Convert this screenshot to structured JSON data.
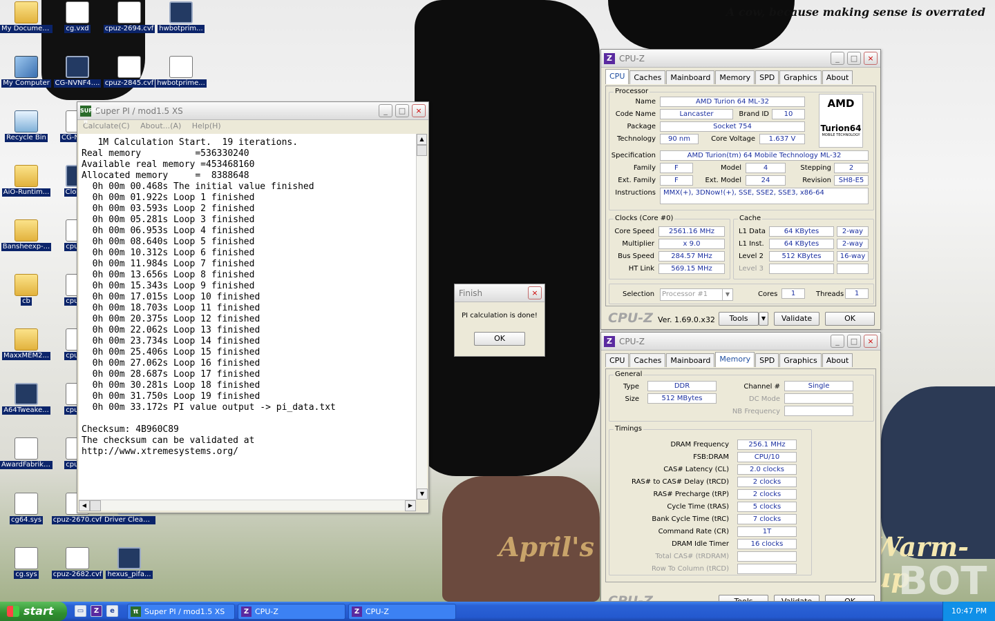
{
  "desktop": {
    "wallpaper_title": "A cow, because making sense is overrated",
    "wallpaper_text_1": "April's",
    "wallpaper_text_2": "Warm-up",
    "wallpaper_text_3": "BOT",
    "icons": [
      {
        "label": "My Documents",
        "type": "folder"
      },
      {
        "label": "cg.vxd",
        "type": "doc"
      },
      {
        "label": "cpuz-2694.cvf",
        "type": "doc"
      },
      {
        "label": "hwbotprim...",
        "type": "app"
      },
      {
        "label": "My Computer",
        "type": "pc"
      },
      {
        "label": "CG-NVNF4....",
        "type": "app"
      },
      {
        "label": "cpuz-2845.cvf",
        "type": "doc"
      },
      {
        "label": "hwbotprime...",
        "type": "doc"
      },
      {
        "label": "Recycle Bin",
        "type": "bin"
      },
      {
        "label": "CG-NVNF",
        "type": "doc"
      },
      {
        "label": "AiO-Runtim...",
        "type": "folder"
      },
      {
        "label": "ClockG",
        "type": "app"
      },
      {
        "label": "Bansheexp-...",
        "type": "folder"
      },
      {
        "label": "cpuz-2",
        "type": "doc"
      },
      {
        "label": "cb",
        "type": "folder"
      },
      {
        "label": "cpuz-2",
        "type": "doc"
      },
      {
        "label": "MaxxMEM2...",
        "type": "folder"
      },
      {
        "label": "cpuz-2",
        "type": "doc"
      },
      {
        "label": "A64Tweake...",
        "type": "app"
      },
      {
        "label": "cpuz-2",
        "type": "doc"
      },
      {
        "label": "AwardFabrik wPrime T...",
        "type": "doc"
      },
      {
        "label": "cpuz-2",
        "type": "doc"
      },
      {
        "label": "cg64.sys",
        "type": "doc"
      },
      {
        "label": "cpuz-2670.cvf",
        "type": "doc"
      },
      {
        "label": "Driver Cleaner Pro",
        "type": "app"
      },
      {
        "label": "cg.sys",
        "type": "doc"
      },
      {
        "label": "cpuz-2682.cvf",
        "type": "doc"
      },
      {
        "label": "hexus_pifa...",
        "type": "app"
      }
    ]
  },
  "superpi": {
    "title": "Super PI / mod1.5 XS",
    "logo": "SUPER π",
    "menu": [
      "Calculate(C)",
      "About...(A)",
      "Help(H)"
    ],
    "header_lines": [
      "   1M Calculation Start.  19 iterations.",
      "Real memory          =536330240",
      "Available real memory =453468160",
      "Allocated memory     =  8388648"
    ],
    "log_lines": [
      "  0h 00m 00.468s The initial value finished",
      "  0h 00m 01.922s Loop 1 finished",
      "  0h 00m 03.593s Loop 2 finished",
      "  0h 00m 05.281s Loop 3 finished",
      "  0h 00m 06.953s Loop 4 finished",
      "  0h 00m 08.640s Loop 5 finished",
      "  0h 00m 10.312s Loop 6 finished",
      "  0h 00m 11.984s Loop 7 finished",
      "  0h 00m 13.656s Loop 8 finished",
      "  0h 00m 15.343s Loop 9 finished",
      "  0h 00m 17.015s Loop 10 finished",
      "  0h 00m 18.703s Loop 11 finished",
      "  0h 00m 20.375s Loop 12 finished",
      "  0h 00m 22.062s Loop 13 finished",
      "  0h 00m 23.734s Loop 14 finished",
      "  0h 00m 25.406s Loop 15 finished",
      "  0h 00m 27.062s Loop 16 finished",
      "  0h 00m 28.687s Loop 17 finished",
      "  0h 00m 30.281s Loop 18 finished",
      "  0h 00m 31.750s Loop 19 finished",
      "  0h 00m 33.172s PI value output -> pi_data.txt"
    ],
    "footer_lines": [
      "Checksum: 4B960C89",
      "The checksum can be validated at",
      "http://www.xtremesystems.org/"
    ]
  },
  "finish_dialog": {
    "title": "Finish",
    "message": "PI calculation is done!",
    "ok": "OK"
  },
  "cpuz1": {
    "title": "CPU-Z",
    "tabs": [
      "CPU",
      "Caches",
      "Mainboard",
      "Memory",
      "SPD",
      "Graphics",
      "About"
    ],
    "active_tab": "CPU",
    "processor_group": "Processor",
    "name_label": "Name",
    "name": "AMD Turion 64 ML-32",
    "codename_label": "Code Name",
    "codename": "Lancaster",
    "brandid_label": "Brand ID",
    "brandid": "10",
    "package_label": "Package",
    "package": "Socket 754",
    "technology_label": "Technology",
    "technology": "90 nm",
    "voltage_label": "Core Voltage",
    "voltage": "1.637 V",
    "spec_label": "Specification",
    "spec": "AMD Turion(tm) 64 Mobile Technology ML-32",
    "family_label": "Family",
    "family": "F",
    "model_label": "Model",
    "model": "4",
    "stepping_label": "Stepping",
    "stepping": "2",
    "extfamily_label": "Ext. Family",
    "extfamily": "F",
    "extmodel_label": "Ext. Model",
    "extmodel": "24",
    "revision_label": "Revision",
    "revision": "SH8-E5",
    "instr_label": "Instructions",
    "instructions": "MMX(+), 3DNow!(+), SSE, SSE2, SSE3, x86-64",
    "logo_amd": "AMD",
    "logo_turion": "Turion64",
    "logo_sub": "MOBILE TECHNOLOGY",
    "clocks_group": "Clocks (Core #0)",
    "corespeed_label": "Core Speed",
    "corespeed": "2561.16 MHz",
    "multiplier_label": "Multiplier",
    "multiplier": "x 9.0",
    "busspeed_label": "Bus Speed",
    "busspeed": "284.57 MHz",
    "htlink_label": "HT Link",
    "htlink": "569.15 MHz",
    "cache_group": "Cache",
    "l1d_label": "L1 Data",
    "l1d": "64 KBytes",
    "l1d_way": "2-way",
    "l1i_label": "L1 Inst.",
    "l1i": "64 KBytes",
    "l1i_way": "2-way",
    "l2_label": "Level 2",
    "l2": "512 KBytes",
    "l2_way": "16-way",
    "l3_label": "Level 3",
    "selection_label": "Selection",
    "selection": "Processor #1",
    "cores_label": "Cores",
    "cores": "1",
    "threads_label": "Threads",
    "threads": "1",
    "brand": "CPU-Z",
    "version": "Ver. 1.69.0.x32",
    "tools": "Tools",
    "validate": "Validate",
    "ok": "OK"
  },
  "cpuz2": {
    "title": "CPU-Z",
    "tabs": [
      "CPU",
      "Caches",
      "Mainboard",
      "Memory",
      "SPD",
      "Graphics",
      "About"
    ],
    "active_tab": "Memory",
    "general_group": "General",
    "type_label": "Type",
    "type": "DDR",
    "size_label": "Size",
    "size": "512 MBytes",
    "channel_label": "Channel #",
    "channel": "Single",
    "dcmode_label": "DC Mode",
    "nbfreq_label": "NB Frequency",
    "timings_group": "Timings",
    "timings": [
      {
        "label": "DRAM Frequency",
        "value": "256.1 MHz",
        "enabled": true
      },
      {
        "label": "FSB:DRAM",
        "value": "CPU/10",
        "enabled": true
      },
      {
        "label": "CAS# Latency (CL)",
        "value": "2.0 clocks",
        "enabled": true
      },
      {
        "label": "RAS# to CAS# Delay (tRCD)",
        "value": "2 clocks",
        "enabled": true
      },
      {
        "label": "RAS# Precharge (tRP)",
        "value": "2 clocks",
        "enabled": true
      },
      {
        "label": "Cycle Time (tRAS)",
        "value": "5 clocks",
        "enabled": true
      },
      {
        "label": "Bank Cycle Time (tRC)",
        "value": "7 clocks",
        "enabled": true
      },
      {
        "label": "Command Rate (CR)",
        "value": "1T",
        "enabled": true
      },
      {
        "label": "DRAM Idle Timer",
        "value": "16 clocks",
        "enabled": true
      },
      {
        "label": "Total CAS# (tRDRAM)",
        "value": "",
        "enabled": false
      },
      {
        "label": "Row To Column (tRCD)",
        "value": "",
        "enabled": false
      }
    ]
  },
  "taskbar": {
    "start": "start",
    "quicklaunch": [
      "desktop",
      "cpu-z",
      "ie"
    ],
    "buttons": [
      "Super PI / mod1.5 XS",
      "CPU-Z",
      "CPU-Z"
    ],
    "clock": "10:47 PM"
  },
  "colors": {
    "value_text": "#1a2fa0",
    "active_tab": "#1f4ea0",
    "taskbar": "#2459cf",
    "start": "#2f8f2f"
  }
}
